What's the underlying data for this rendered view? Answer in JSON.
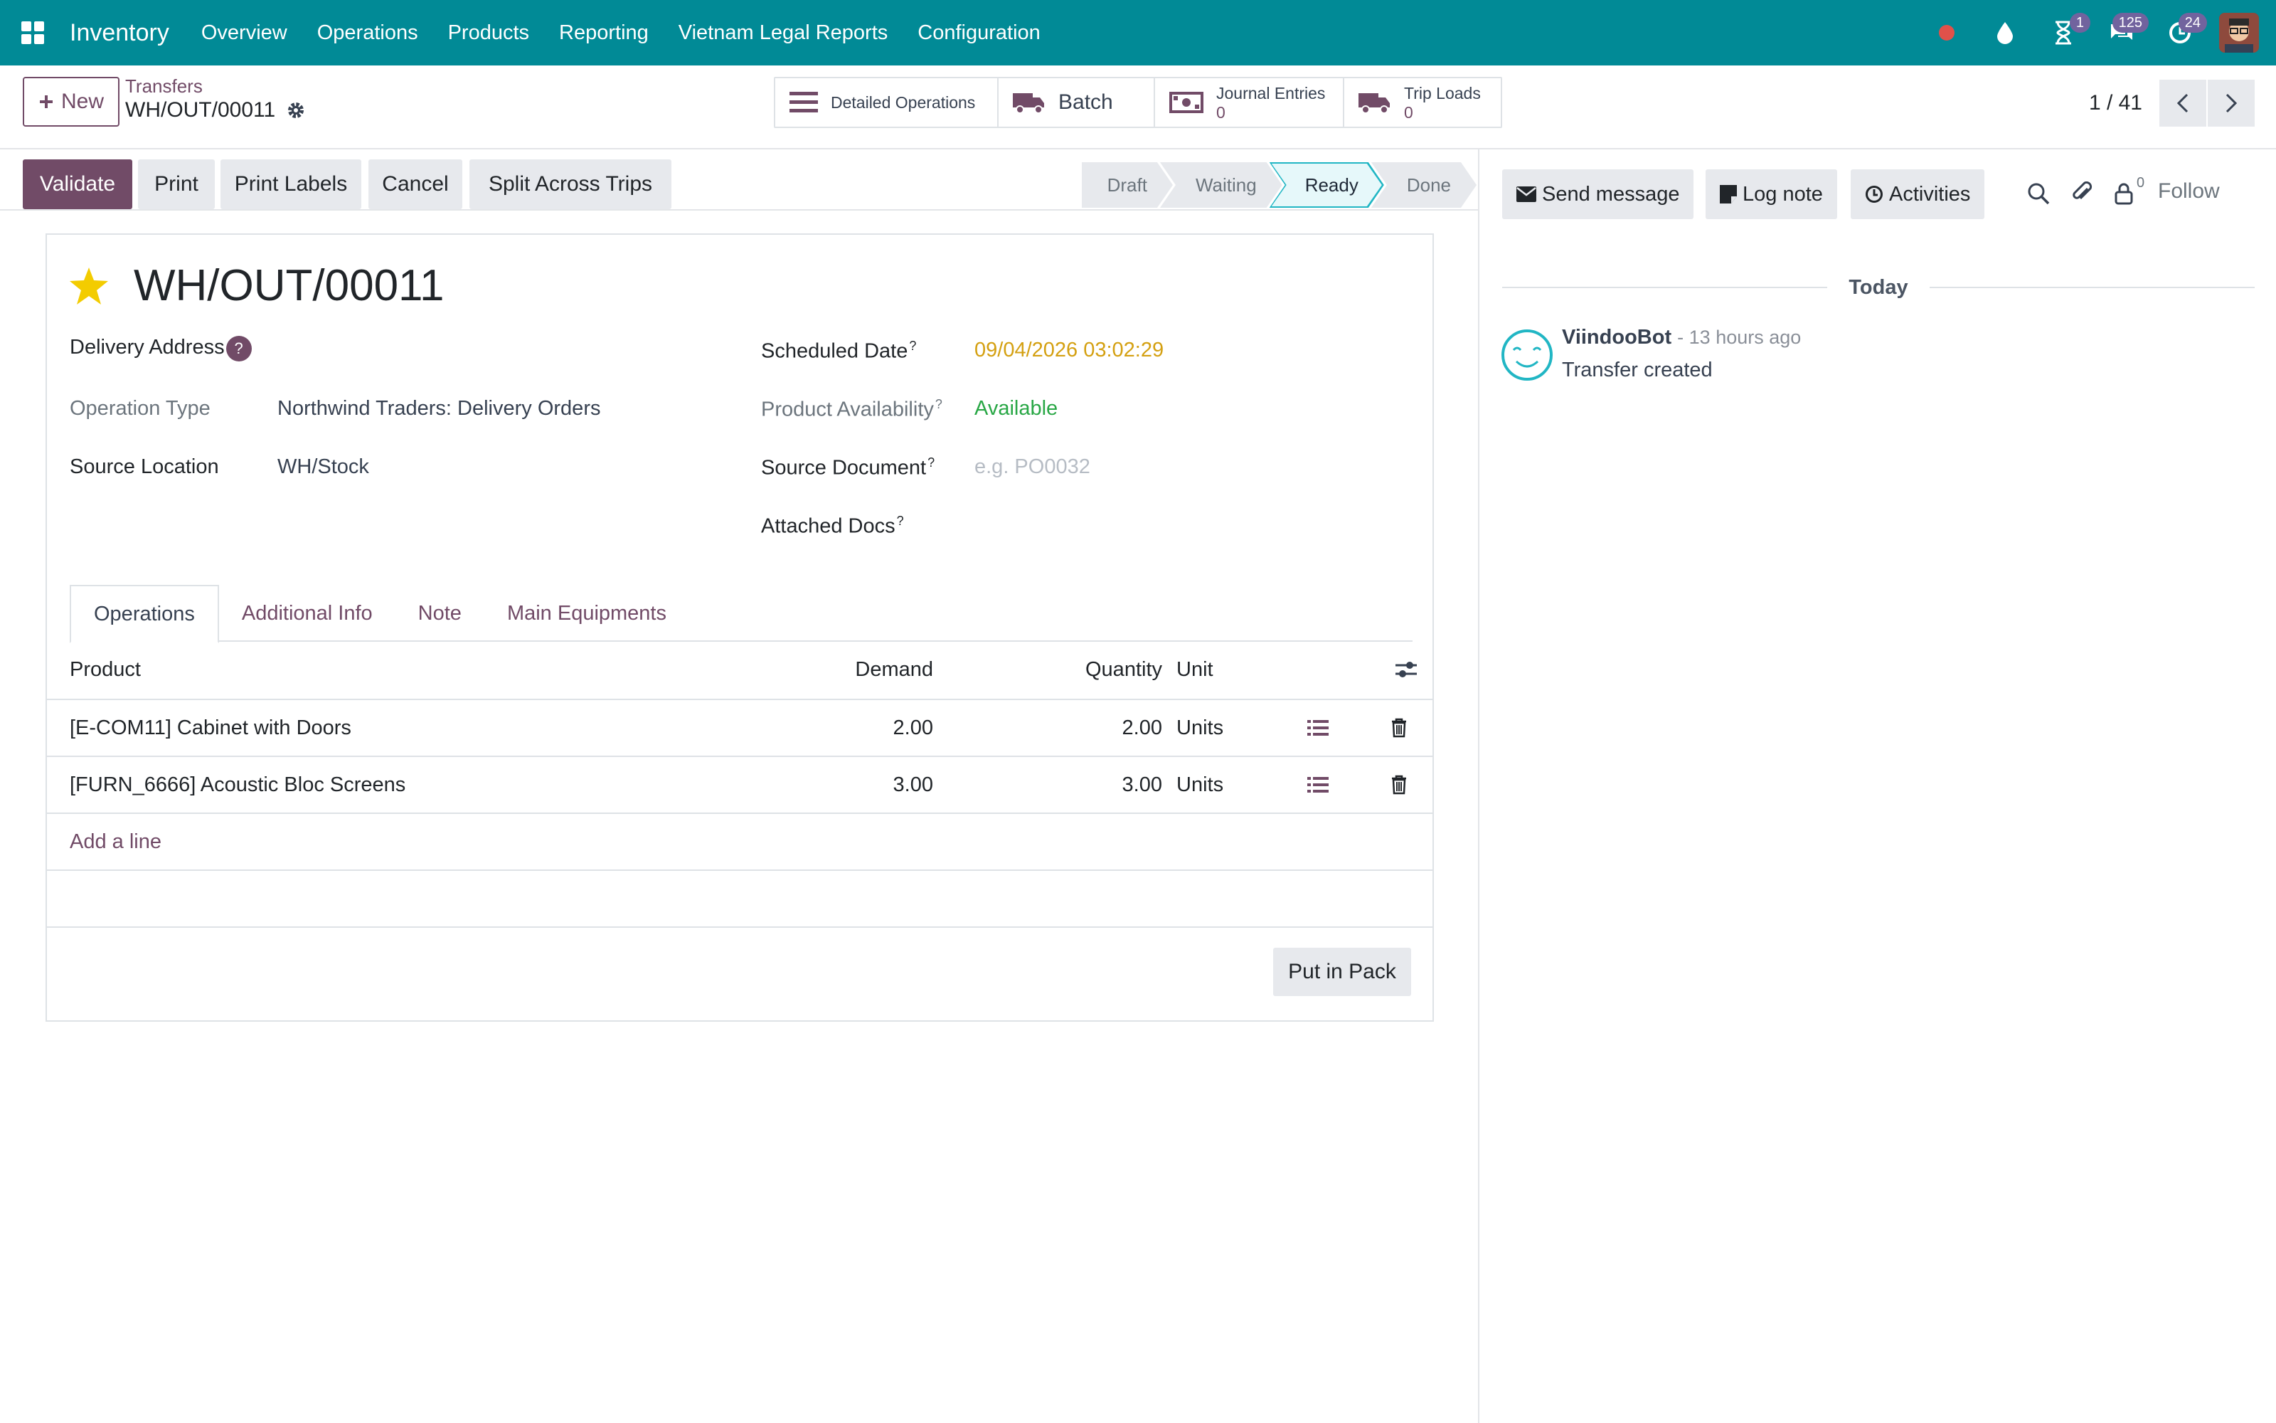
{
  "navbar": {
    "app_name": "Inventory",
    "menus": [
      "Overview",
      "Operations",
      "Products",
      "Reporting",
      "Vietnam Legal Reports",
      "Configuration"
    ],
    "badges": {
      "activities": "1",
      "messages": "125",
      "updates": "24"
    },
    "icons": [
      "apps-grid-icon",
      "red-status-dot-icon",
      "droplet-icon",
      "hourglass-icon",
      "chat-icon",
      "clock-refresh-icon"
    ]
  },
  "control": {
    "new_label": "New",
    "breadcrumb": "Transfers",
    "record_name": "WH/OUT/00011",
    "smart_buttons": [
      {
        "label": "Detailed Operations",
        "icon": "list-icon"
      },
      {
        "label": "Batch",
        "icon": "truck-icon"
      },
      {
        "label": "Journal Entries",
        "count": "0",
        "icon": "money-icon"
      },
      {
        "label": "Trip Loads",
        "count": "0",
        "icon": "truck-icon"
      }
    ],
    "pager": "1 / 41"
  },
  "statusbar": {
    "buttons": [
      "Validate",
      "Print",
      "Print Labels",
      "Cancel",
      "Split Across Trips"
    ],
    "stages": [
      "Draft",
      "Waiting",
      "Ready",
      "Done"
    ],
    "active_stage": "Ready"
  },
  "form": {
    "title": "WH/OUT/00011",
    "delivery_address_label": "Delivery Address",
    "help_mark": "?",
    "operation_type_label": "Operation Type",
    "operation_type_value": "Northwind Traders: Delivery Orders",
    "source_location_label": "Source Location",
    "source_location_value": "WH/Stock",
    "scheduled_date_label": "Scheduled Date",
    "scheduled_date_value": "09/04/2026 03:02:29",
    "availability_label": "Product Availability",
    "availability_value": "Available",
    "source_document_label": "Source Document",
    "source_document_placeholder": "e.g. PO0032",
    "attached_docs_label": "Attached Docs",
    "colors": {
      "date": "#d4a011",
      "available": "#28a745",
      "accent": "#714b67"
    }
  },
  "tabs": [
    "Operations",
    "Additional Info",
    "Note",
    "Main Equipments"
  ],
  "table": {
    "headers": {
      "product": "Product",
      "demand": "Demand",
      "quantity": "Quantity",
      "unit": "Unit"
    },
    "rows": [
      {
        "product": "[E-COM11] Cabinet with Doors",
        "demand": "2.00",
        "quantity": "2.00",
        "unit": "Units"
      },
      {
        "product": "[FURN_6666] Acoustic Bloc Screens",
        "demand": "3.00",
        "quantity": "3.00",
        "unit": "Units"
      }
    ],
    "add_line": "Add a line",
    "put_in_pack": "Put in Pack"
  },
  "chatter": {
    "send_message": "Send message",
    "log_note": "Log note",
    "activities": "Activities",
    "followers_count": "0",
    "follow": "Follow",
    "today": "Today",
    "message": {
      "author": "ViindooBot",
      "time": "- 13 hours ago",
      "body": "Transfer created"
    }
  }
}
